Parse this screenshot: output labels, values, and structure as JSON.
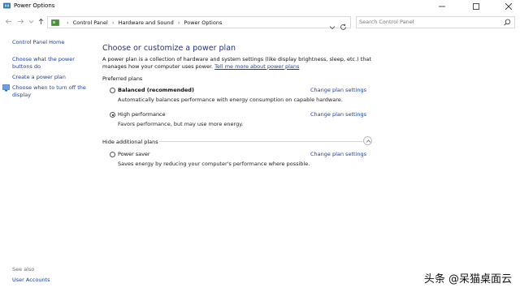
{
  "window": {
    "title": "Power Options",
    "icon": "power-options-icon",
    "controls": [
      "minimize-icon",
      "maximize-icon",
      "close-icon"
    ]
  },
  "address_bar": {
    "breadcrumbs": [
      "Control Panel",
      "Hardware and Sound",
      "Power Options"
    ],
    "search_placeholder": "Search Control Panel"
  },
  "sidebar": {
    "links": [
      "Control Panel Home",
      "Choose what the power buttons do",
      "Create a power plan",
      "Choose when to turn off the display"
    ],
    "see_also_heading": "See also",
    "see_also_links": [
      "User Accounts"
    ]
  },
  "main": {
    "title": "Choose or customize a power plan",
    "description": "A power plan is a collection of hardware and system settings (like display brightness, sleep, etc.) that manages how your computer uses power.",
    "learn_more_link": "Tell me more about power plans",
    "preferred_heading": "Preferred plans",
    "hide_additional_heading": "Hide additional plans",
    "change_link_label": "Change plan settings",
    "plans": [
      {
        "name": "Balanced (recommended)",
        "description": "Automatically balances performance with energy consumption on capable hardware.",
        "selected": false
      },
      {
        "name": "High performance",
        "description": "Favors performance, but may use more energy.",
        "selected": true
      },
      {
        "name": "Power saver",
        "description": "Saves energy by reducing your computer's performance where possible.",
        "selected": false
      }
    ]
  },
  "watermark": "头条 @呆猫桌面云",
  "colors": {
    "link": "#1a3e9c",
    "heading": "#1e3287",
    "border": "#d9d9d9"
  }
}
